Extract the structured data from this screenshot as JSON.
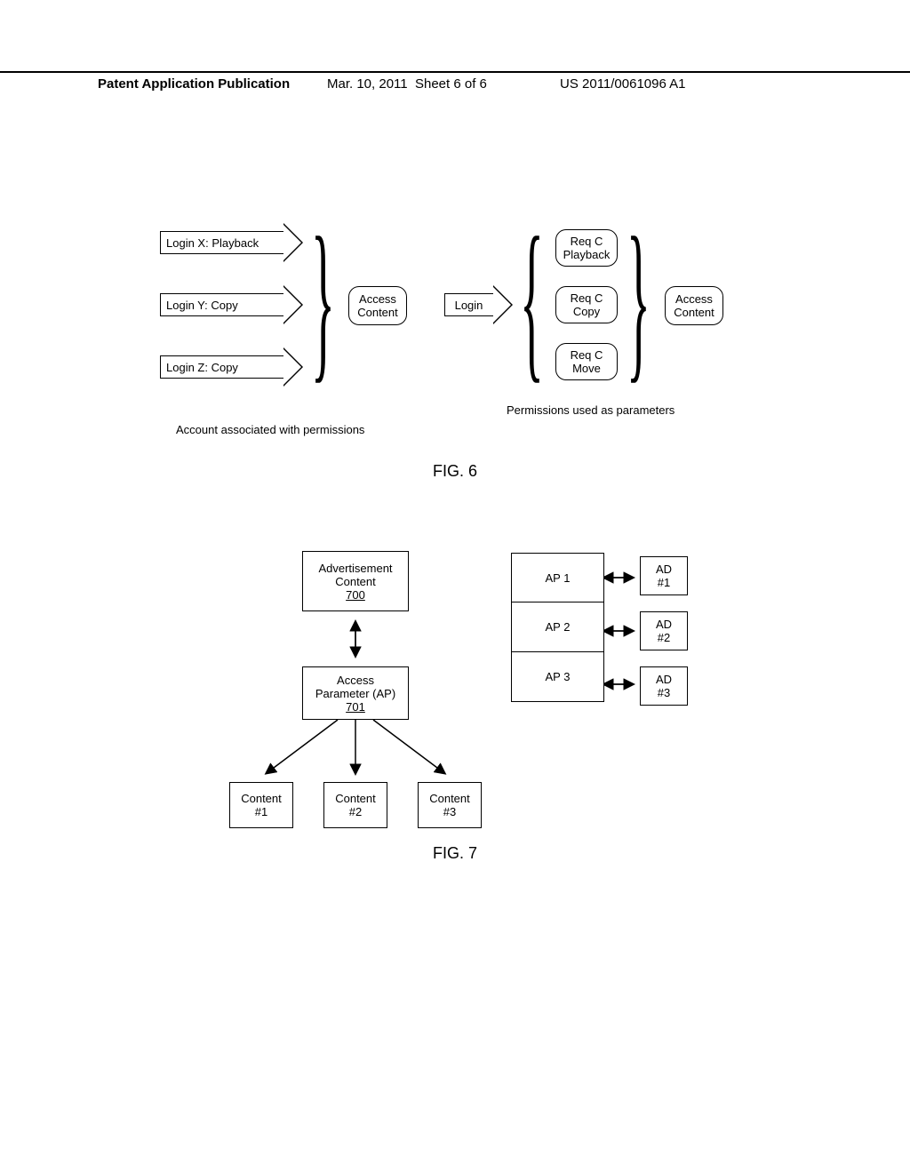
{
  "header": {
    "left": "Patent Application Publication",
    "mid_date": "Mar. 10, 2011",
    "mid_sheet": "Sheet 6 of 6",
    "right": "US 2011/0061096 A1"
  },
  "fig6": {
    "login_x": "Login X: Playback",
    "login_y": "Login Y: Copy",
    "login_z": "Login Z: Copy",
    "access_content": "Access\nContent",
    "caption_left": "Account associated with permissions",
    "login": "Login",
    "req_playback": "Req C\nPlayback",
    "req_copy": "Req C\nCopy",
    "req_move": "Req C\nMove",
    "caption_right": "Permissions used as parameters",
    "fig_label": "FIG. 6"
  },
  "fig7": {
    "adv": "Advertisement\nContent",
    "adv_ref": "700",
    "ap": "Access\nParameter (AP)",
    "ap_ref": "701",
    "c1": "Content\n#1",
    "c2": "Content\n#2",
    "c3": "Content\n#3",
    "ap1": "AP 1",
    "ap2": "AP 2",
    "ap3": "AP 3",
    "ad1": "AD\n#1",
    "ad2": "AD\n#2",
    "ad3": "AD\n#3",
    "fig_label": "FIG. 7"
  }
}
